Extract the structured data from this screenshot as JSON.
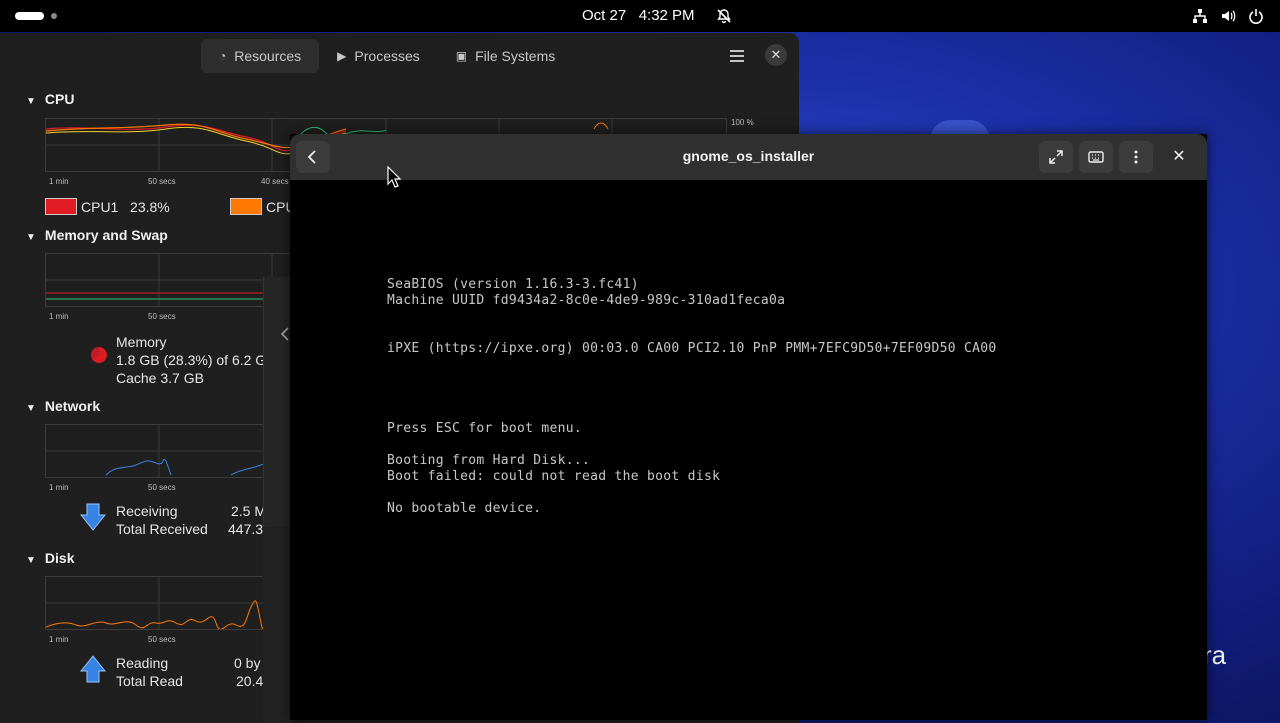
{
  "topbar": {
    "clock": "Oct 27   4:32 PM"
  },
  "monitor": {
    "tabs": [
      {
        "label": "Resources"
      },
      {
        "label": "Processes"
      },
      {
        "label": "File Systems"
      }
    ],
    "cpu": {
      "title": "CPU",
      "graph_top_label": "100 %",
      "axis": [
        "1 min",
        "50 secs",
        "40 secs"
      ],
      "legend": [
        {
          "name": "CPU1",
          "value": "23.8%",
          "color": "#e01b24"
        },
        {
          "name": "CPU",
          "value": "",
          "color": "#ff7800"
        }
      ]
    },
    "memory": {
      "title": "Memory and Swap",
      "axis": [
        "1 min",
        "50 secs"
      ],
      "label": "Memory",
      "used": "1.8 GB (28.3%) of 6.2 G",
      "cache": "Cache 3.7 GB"
    },
    "network": {
      "title": "Network",
      "axis": [
        "1 min",
        "50 secs"
      ],
      "receiving_label": "Receiving",
      "receiving_value": "2.5 M",
      "total_label": "Total Received",
      "total_value": "447.3"
    },
    "disk": {
      "title": "Disk",
      "axis": [
        "1 min",
        "50 secs"
      ],
      "reading_label": "Reading",
      "reading_value": "0 by",
      "total_label": "Total Read",
      "total_value": "20.4"
    }
  },
  "vm": {
    "title": "gnome_os_installer",
    "console": [
      "SeaBIOS (version 1.16.3-3.fc41)",
      "Machine UUID fd9434a2-8c0e-4de9-989c-310ad1feca0a",
      "iPXE (https://ipxe.org) 00:03.0 CA00 PCI2.10 PnP PMM+7EFC9D50+7EF09D50 CA00",
      "Press ESC for boot menu.",
      "Booting from Hard Disk...",
      "Boot failed: could not read the boot disk",
      "No bootable device."
    ]
  },
  "desktop": {
    "fragment": "ra"
  }
}
